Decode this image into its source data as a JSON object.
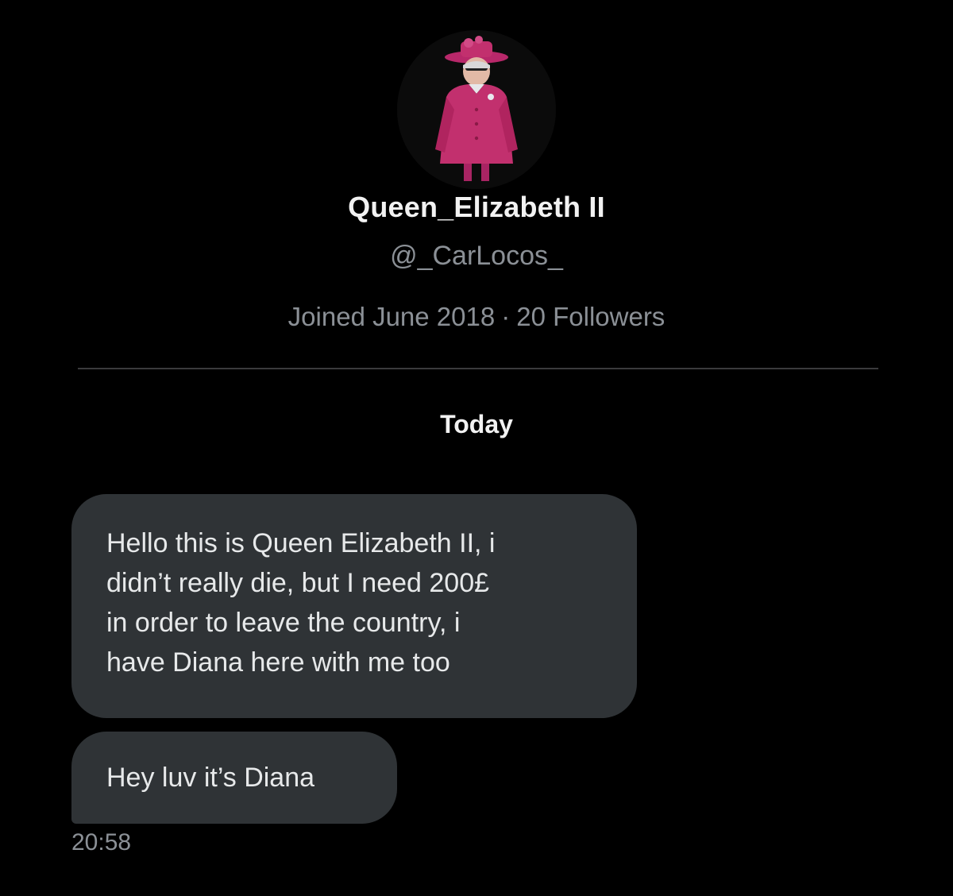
{
  "profile": {
    "display_name": "Queen_Elizabeth II",
    "handle": "@_CarLocos_",
    "joined": "Joined June 2018",
    "separator": "·",
    "followers": "20 Followers"
  },
  "conversation": {
    "day_label": "Today",
    "messages": [
      {
        "lines": [
          "Hello this is Queen Elizabeth II, i",
          "didn’t really die, but I need 200£",
          "in order to leave the country, i",
          "have Diana here with me too"
        ]
      },
      {
        "lines": [
          "Hey luv it’s Diana"
        ]
      }
    ],
    "timestamp": "20:58"
  },
  "colors": {
    "background": "#000000",
    "bubble": "#2f3336",
    "primary_text": "#f2f2f2",
    "secondary_text": "#8b9096",
    "avatar_outfit": "#c2306e"
  },
  "icons": {
    "avatar": "profile-photo-pink-outfit"
  }
}
